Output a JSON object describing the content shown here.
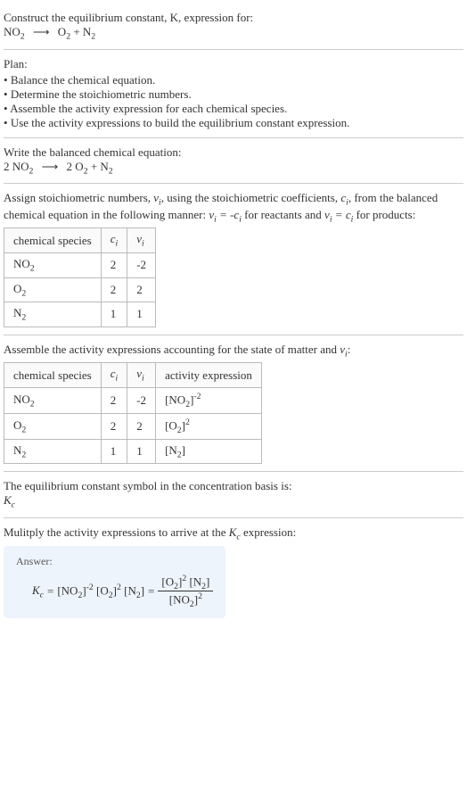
{
  "header": {
    "prompt": "Construct the equilibrium constant, K, expression for:"
  },
  "plan": {
    "title": "Plan:",
    "items": [
      "Balance the chemical equation.",
      "Determine the stoichiometric numbers.",
      "Assemble the activity expression for each chemical species.",
      "Use the activity expressions to build the equilibrium constant expression."
    ]
  },
  "balanced": {
    "intro": "Write the balanced chemical equation:"
  },
  "stoich": {
    "intro_part1": "Assign stoichiometric numbers, ",
    "intro_part2": ", using the stoichiometric coefficients, ",
    "intro_part3": ", from the balanced chemical equation in the following manner: ",
    "intro_part4": " for reactants and ",
    "intro_part5": " for products:",
    "headers": {
      "species": "chemical species"
    },
    "rows": [
      {
        "species": "NO",
        "sub": "2",
        "c": "2",
        "v": "-2"
      },
      {
        "species": "O",
        "sub": "2",
        "c": "2",
        "v": "2"
      },
      {
        "species": "N",
        "sub": "2",
        "c": "1",
        "v": "1"
      }
    ]
  },
  "activity": {
    "intro": "Assemble the activity expressions accounting for the state of matter and ",
    "intro_suffix": ":",
    "headers": {
      "species": "chemical species",
      "activity": "activity expression"
    },
    "rows": [
      {
        "species": "NO",
        "sub": "2",
        "c": "2",
        "v": "-2",
        "act_base": "NO",
        "act_sub": "2",
        "act_exp": "-2"
      },
      {
        "species": "O",
        "sub": "2",
        "c": "2",
        "v": "2",
        "act_base": "O",
        "act_sub": "2",
        "act_exp": "2"
      },
      {
        "species": "N",
        "sub": "2",
        "c": "1",
        "v": "1",
        "act_base": "N",
        "act_sub": "2",
        "act_exp": ""
      }
    ]
  },
  "symbol": {
    "intro": "The equilibrium constant symbol in the concentration basis is:"
  },
  "multiply": {
    "intro": "Mulitply the activity expressions to arrive at the ",
    "intro_suffix": " expression:"
  },
  "answer": {
    "label": "Answer:"
  }
}
